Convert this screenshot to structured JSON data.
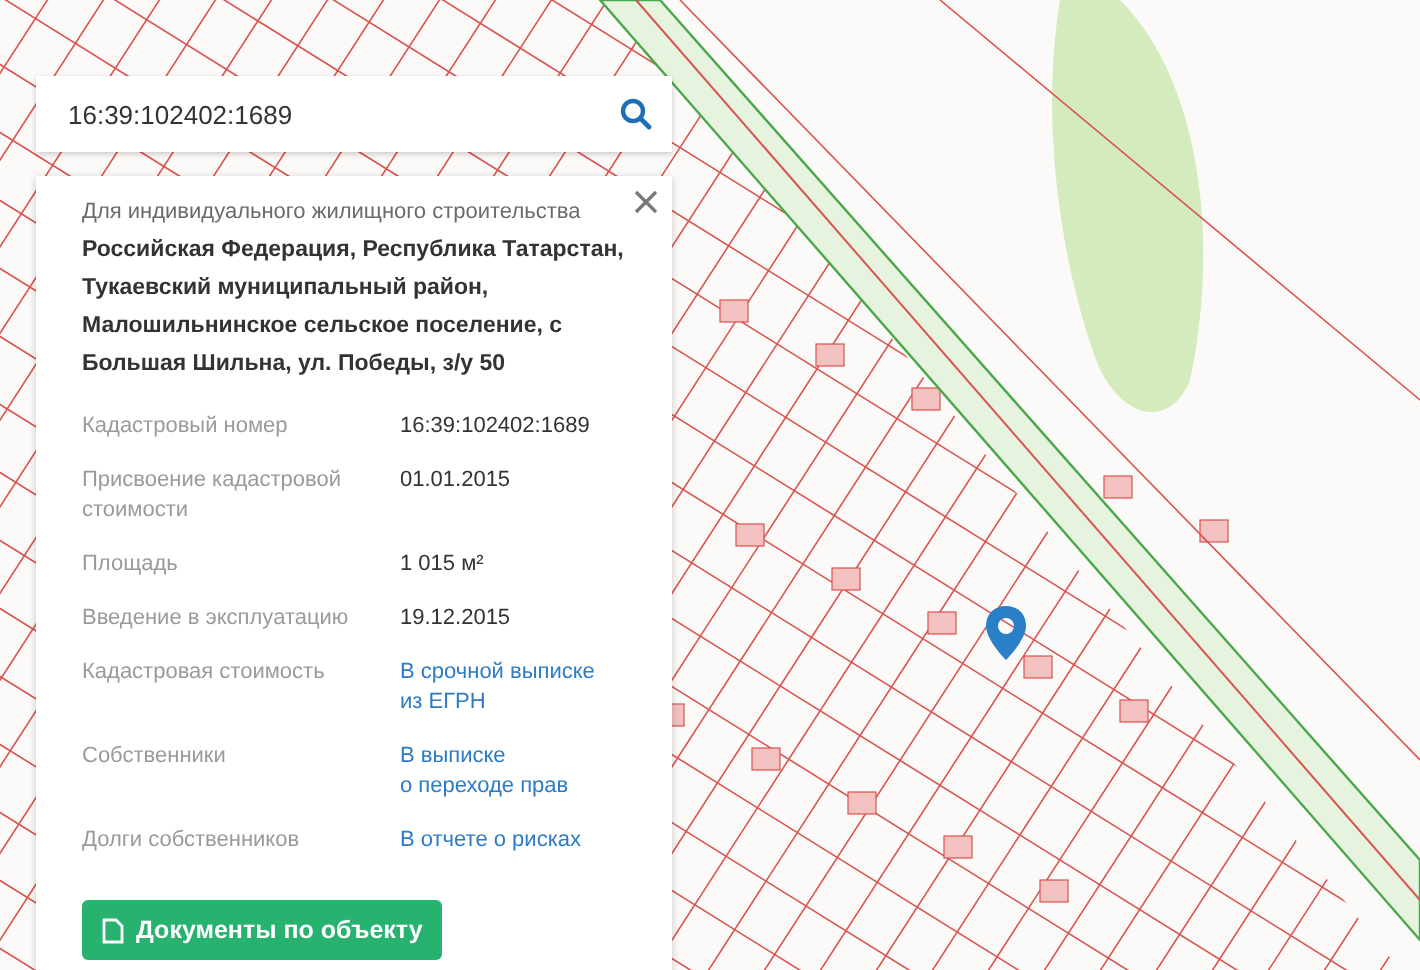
{
  "search": {
    "value": "16:39:102402:1689"
  },
  "card": {
    "purpose": "Для индивидуального жилищного строительства",
    "address": "Российская Федерация, Республика Татарстан, Тукаевский муниципальный район, Малошильнинское сельское поселение, с Большая Шильна, ул. Победы, з/у 50",
    "rows": [
      {
        "kind": "text",
        "label": "Кадастровый номер",
        "value": "16:39:102402:1689"
      },
      {
        "kind": "text",
        "label": "Присвоение кадастровой стоимости",
        "value": "01.01.2015"
      },
      {
        "kind": "text",
        "label": "Площадь",
        "value": "1 015 м²"
      },
      {
        "kind": "text",
        "label": "Введение в эксплуатацию",
        "value": "19.12.2015"
      },
      {
        "kind": "link",
        "label": "Кадастровая стоимость",
        "value": "В срочной выписке\nиз ЕГРН"
      },
      {
        "kind": "link",
        "label": "Собственники",
        "value": "В выписке\nо переходе прав"
      },
      {
        "kind": "link",
        "label": "Долги собственников",
        "value": "В отчете о рисках"
      }
    ],
    "button": "Документы по объекту"
  }
}
